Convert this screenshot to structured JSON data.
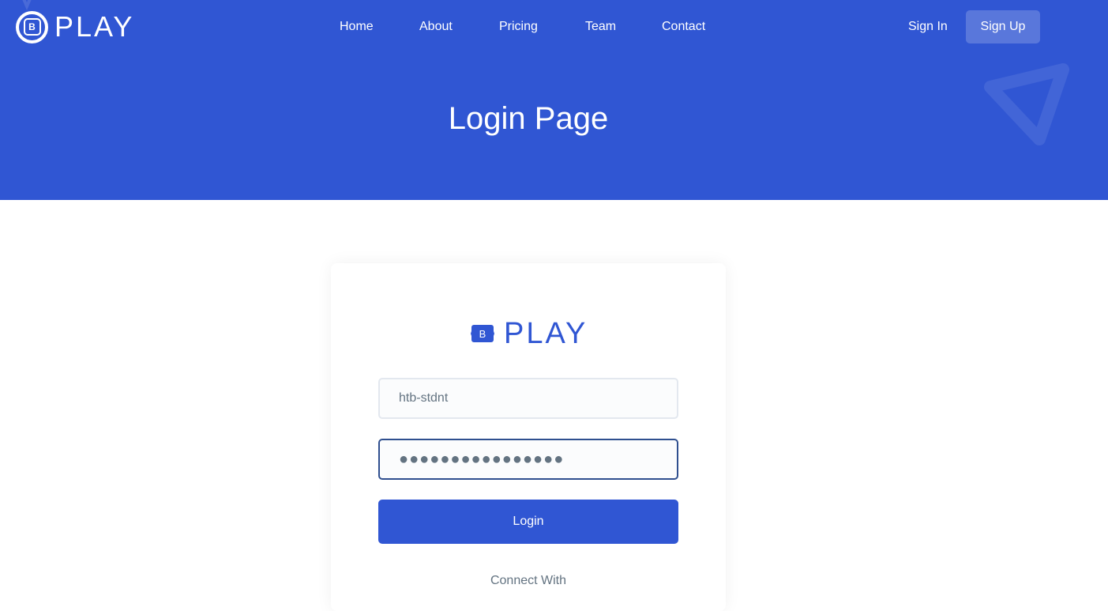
{
  "brand": {
    "name": "PLAY",
    "badge_letter": "B"
  },
  "nav": {
    "items": [
      "Home",
      "About",
      "Pricing",
      "Team",
      "Contact"
    ]
  },
  "auth": {
    "sign_in": "Sign In",
    "sign_up": "Sign Up"
  },
  "hero": {
    "title": "Login Page"
  },
  "login_form": {
    "username_value": "htb-stdnt",
    "password_masked": "●●●●●●●●●●●●●●●●",
    "submit_label": "Login",
    "connect_label": "Connect With"
  },
  "colors": {
    "primary": "#3056d3",
    "text_muted": "#637381",
    "white": "#ffffff"
  }
}
